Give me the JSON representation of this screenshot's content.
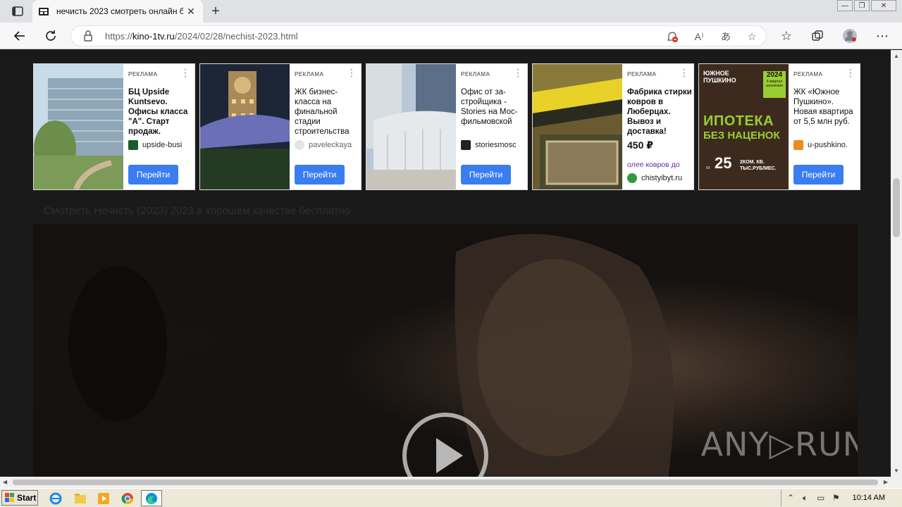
{
  "browser": {
    "tab_title": "нечисть 2023 смотреть онлайн б",
    "tab_close": "✕",
    "new_tab": "+",
    "url_prefix": "https://",
    "url_host": "kino-1tv.ru",
    "url_path": "/2024/02/28/nechist-2023.html",
    "min": "—",
    "max": "❐",
    "close": "✕"
  },
  "ads": [
    {
      "badge": "РЕКЛАМА",
      "headline": "БЦ Upside Kuntsevo. Офисы класса \"А\". Старт продаж.",
      "price": "",
      "extra": "",
      "source": "upside-busi",
      "cta": "Перейти",
      "thumb_color": "#8fb3c9",
      "icon_color": "#1a5c2a"
    },
    {
      "badge": "РЕКЛАМА",
      "headline": "ЖК бизнес-класса на финальной стадии строительства",
      "price": "",
      "extra": "",
      "source": "paveleckaya",
      "cta": "Перейти",
      "thumb_color": "#1f2a3a",
      "icon_color": "#cfcfcf"
    },
    {
      "badge": "РЕКЛАМА",
      "headline": "Офис от за-стройщика - Stories на Мос-фильмовской",
      "price": "",
      "extra": "",
      "source": "storiesmosc",
      "cta": "Перейти",
      "thumb_color": "#9eb2c8",
      "icon_color": "#222222"
    },
    {
      "badge": "РЕКЛАМА",
      "headline": "Фабрика стирки ковров в Люберцах. Вывоз и доставка!",
      "price": "450 ₽",
      "extra": "олее ковров до",
      "source": "chistyibyt.ru",
      "cta": "",
      "thumb_color": "#5a4a2a",
      "icon_color": "#2f9a3f"
    },
    {
      "badge": "РЕКЛАМА",
      "headline": "ЖК «Южное Пушкино». Новая квартира от 5,5 млн руб.",
      "price": "",
      "extra": "",
      "source": "u-pushkino.",
      "cta": "Перейти",
      "thumb_color": "#3d2a1e",
      "icon_color": "#f08a1c",
      "thumb_text": {
        "brand": "ЮЖНОЕ ПУШКИНО",
        "year": "2024",
        "year_sub": "4 квартал заселение",
        "promo1": "ИПОТЕКА",
        "promo2": "БЕЗ НАЦЕНОК",
        "from": "от",
        "num": "25",
        "detail": "2КОМ. КВ. ТЫС.РУБ/МЕС."
      }
    }
  ],
  "section_title": "Смотреть Нечисть (2023) 2023 в хорошем качестве бесплатно",
  "player": {
    "watermark": "ANY▷RUN"
  },
  "taskbar": {
    "start_label": "Start",
    "clock": "10:14 AM"
  },
  "colors": {
    "accent": "#3a7df0",
    "page_bg": "#1a1a1a"
  }
}
